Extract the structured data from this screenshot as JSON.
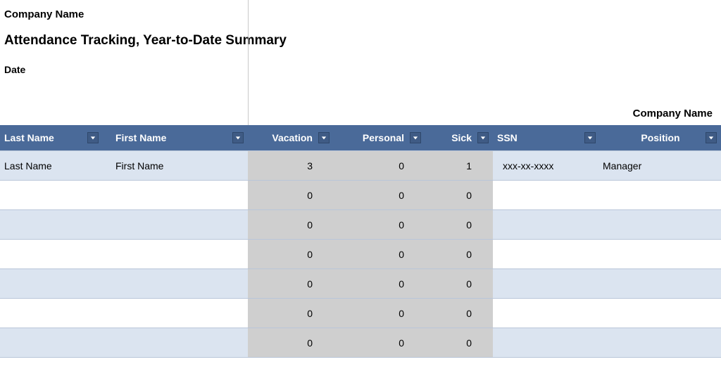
{
  "header": {
    "company_label": "Company Name",
    "title": "Attendance Tracking, Year-to-Date Summary",
    "date_label": "Date",
    "company_right": "Company Name"
  },
  "columns": {
    "last_name": "Last Name",
    "first_name": "First Name",
    "vacation": "Vacation",
    "personal": "Personal",
    "sick": "Sick",
    "ssn": "SSN",
    "position": "Position"
  },
  "rows": [
    {
      "last_name": "Last Name",
      "first_name": "First Name",
      "vacation": "3",
      "personal": "0",
      "sick": "1",
      "ssn": "xxx-xx-xxxx",
      "position": "Manager"
    },
    {
      "last_name": "",
      "first_name": "",
      "vacation": "0",
      "personal": "0",
      "sick": "0",
      "ssn": "",
      "position": ""
    },
    {
      "last_name": "",
      "first_name": "",
      "vacation": "0",
      "personal": "0",
      "sick": "0",
      "ssn": "",
      "position": ""
    },
    {
      "last_name": "",
      "first_name": "",
      "vacation": "0",
      "personal": "0",
      "sick": "0",
      "ssn": "",
      "position": ""
    },
    {
      "last_name": "",
      "first_name": "",
      "vacation": "0",
      "personal": "0",
      "sick": "0",
      "ssn": "",
      "position": ""
    },
    {
      "last_name": "",
      "first_name": "",
      "vacation": "0",
      "personal": "0",
      "sick": "0",
      "ssn": "",
      "position": ""
    },
    {
      "last_name": "",
      "first_name": "",
      "vacation": "0",
      "personal": "0",
      "sick": "0",
      "ssn": "",
      "position": ""
    }
  ],
  "colors": {
    "header_bg": "#4a6a99",
    "band_a": "#dbe4f0",
    "num_bg": "#cfcfcf"
  }
}
